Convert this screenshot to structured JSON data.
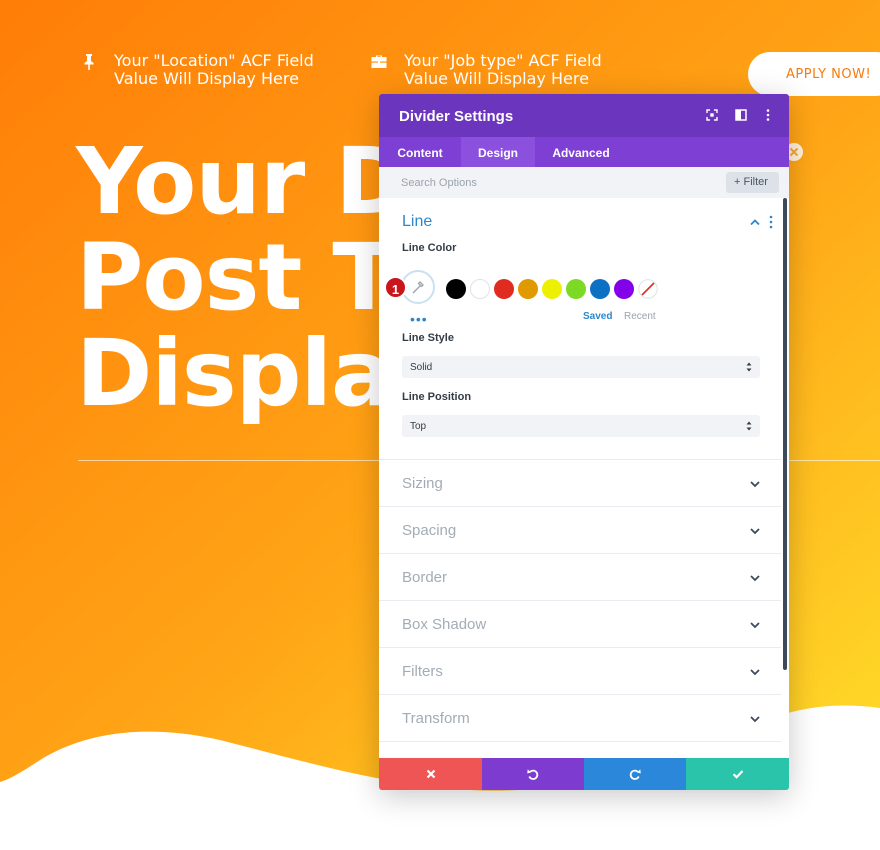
{
  "hero": {
    "meta_location": "Your \"Location\" ACF Field\nValue Will Display Here",
    "meta_jobtype": "Your \"Job type\" ACF Field\nValue Will Display Here",
    "apply_button": "APPLY NOW!",
    "title": "Your D     c\nPost T      ll\nDispla",
    "colors": {
      "gradient_start": "#ff7f0a",
      "gradient_end": "#ffd426"
    }
  },
  "modal": {
    "title": "Divider Settings",
    "tabs": [
      {
        "label": "Content",
        "active": false
      },
      {
        "label": "Design",
        "active": true
      },
      {
        "label": "Advanced",
        "active": false
      }
    ],
    "search": {
      "placeholder": "Search Options",
      "filter_label": "+ Filter"
    },
    "line_group": {
      "title": "Line",
      "line_color_label": "Line Color",
      "badge": "1",
      "swatches": [
        "#000000",
        "#ffffff",
        "#e02b20",
        "#e09900",
        "#edf000",
        "#7cda24",
        "#0c71c3",
        "#8300e9"
      ],
      "saved_label": "Saved",
      "recent_label": "Recent",
      "line_style_label": "Line Style",
      "line_style_value": "Solid",
      "line_position_label": "Line Position",
      "line_position_value": "Top"
    },
    "groups": [
      {
        "label": "Sizing"
      },
      {
        "label": "Spacing"
      },
      {
        "label": "Border"
      },
      {
        "label": "Box Shadow"
      },
      {
        "label": "Filters"
      },
      {
        "label": "Transform"
      }
    ],
    "footer": {
      "cancel_color": "#ef5555",
      "undo_color": "#7e3bd0",
      "redo_color": "#2b87da",
      "save_color": "#29c4a9"
    }
  }
}
